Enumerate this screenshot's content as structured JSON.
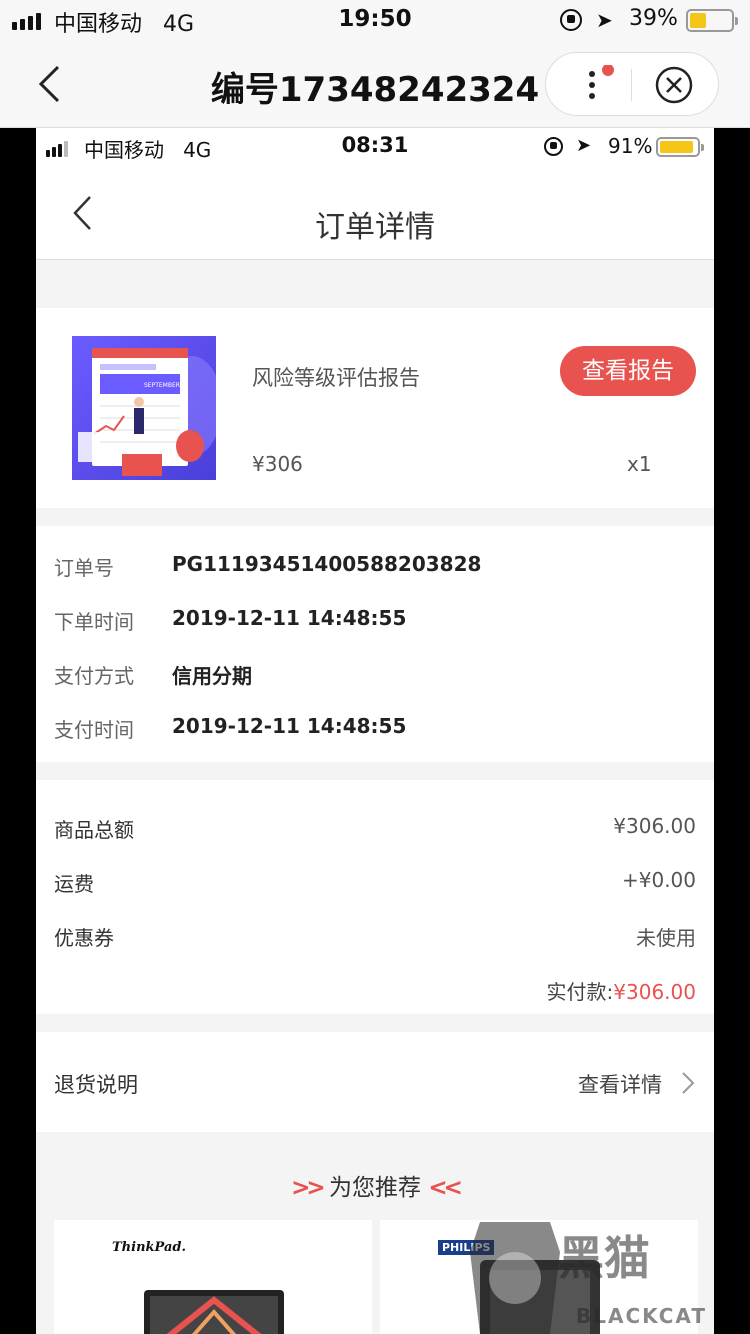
{
  "outer_status": {
    "carrier": "中国移动",
    "network": "4G",
    "time": "19:50",
    "battery_pct": "39%",
    "battery_level": 0.39
  },
  "outer_nav": {
    "title": "编号17348242324"
  },
  "inner_status": {
    "carrier": "中国移动",
    "network": "4G",
    "time": "08:31",
    "battery_pct": "91%",
    "battery_level": 0.91
  },
  "inner_nav": {
    "title": "订单详情"
  },
  "product": {
    "name": "风险等级评估报告",
    "price": "¥306",
    "qty": "x1",
    "button": "查看报告",
    "thumb_text": "SEPTEMBER"
  },
  "order_info": [
    {
      "label": "订单号",
      "value": "PG11193451400588203828"
    },
    {
      "label": "下单时间",
      "value": "2019-12-11 14:48:55"
    },
    {
      "label": "支付方式",
      "value": "信用分期"
    },
    {
      "label": "支付时间",
      "value": "2019-12-11 14:48:55"
    }
  ],
  "amounts": [
    {
      "label": "商品总额",
      "value": "¥306.00"
    },
    {
      "label": "运费",
      "value": "+¥0.00"
    },
    {
      "label": "优惠券",
      "value": "未使用"
    }
  ],
  "total": {
    "label": "实付款:",
    "value": "¥306.00"
  },
  "returns": {
    "label": "退货说明",
    "link": "查看详情"
  },
  "recommend": {
    "title": "为您推荐",
    "items": [
      {
        "brand": "ThinkPad."
      },
      {
        "brand": "PHILIPS"
      }
    ]
  },
  "watermark": {
    "text": "黑猫",
    "sub": "BLACKCAT"
  },
  "colors": {
    "accent": "#e8524f",
    "battery": "#f5c518",
    "page_bg": "#f4f4f4"
  }
}
